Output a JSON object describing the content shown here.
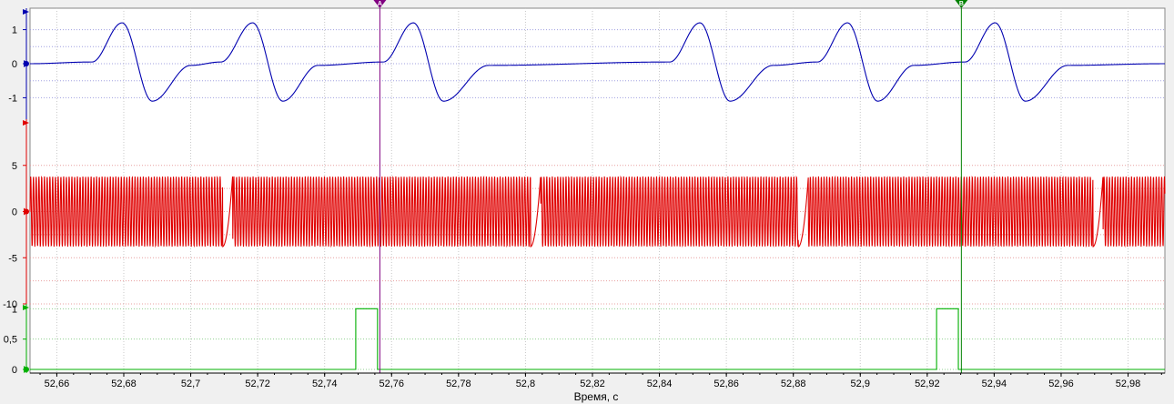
{
  "x_axis": {
    "label": "Время, с",
    "range": [
      52.652,
      52.991
    ],
    "ticks": [
      52.66,
      52.68,
      52.7,
      52.72,
      52.74,
      52.76,
      52.78,
      52.8,
      52.82,
      52.84,
      52.86,
      52.88,
      52.9,
      52.92,
      52.94,
      52.96,
      52.98
    ],
    "tick_labels": [
      "52,66",
      "52,68",
      "52,7",
      "52,72",
      "52,74",
      "52,76",
      "52,78",
      "52,8",
      "52,82",
      "52,84",
      "52,86",
      "52,88",
      "52,9",
      "52,92",
      "52,94",
      "52,96",
      "52,98"
    ]
  },
  "cursors": [
    {
      "name": "cursor-a",
      "letter": "A",
      "time": 52.7565,
      "color": "#800080"
    },
    {
      "name": "cursor-b",
      "letter": "B",
      "time": 52.9302,
      "color": "#008000"
    }
  ],
  "colors": {
    "channel_1": "#0000b0",
    "channel_2": "#e00000",
    "channel_3": "#00b000",
    "grid": "#c8c8c8",
    "plot_background": "#ffffff",
    "frame": "#f0f0f0"
  },
  "chart_data": [
    {
      "type": "line",
      "name": "channel-1",
      "ylim": [
        -1.63,
        1.63
      ],
      "y_ticks": [
        "1",
        "0",
        "-1"
      ],
      "tick_values": [
        1,
        0,
        -1
      ],
      "gridlines": [
        1,
        0.5,
        0,
        -0.5,
        -1
      ],
      "shape": "periodic pulse: positive peak ~1.2 followed by negative peak ~-1.1, baseline 0",
      "x": [
        52.652,
        52.6705,
        52.6795,
        52.6885,
        52.7,
        52.709,
        52.7185,
        52.7275,
        52.738,
        52.7575,
        52.7665,
        52.7755,
        52.789,
        52.8431,
        52.8521,
        52.8611,
        52.874,
        52.8872,
        52.8962,
        52.9052,
        52.916,
        52.9313,
        52.9403,
        52.9493,
        52.962,
        52.991
      ],
      "y": [
        0.0,
        0.05,
        1.2,
        -1.1,
        -0.05,
        0.05,
        1.2,
        -1.1,
        -0.05,
        0.05,
        1.2,
        -1.1,
        -0.05,
        0.05,
        1.2,
        -1.1,
        -0.05,
        0.05,
        1.2,
        -1.1,
        -0.05,
        0.05,
        1.2,
        -1.1,
        -0.05,
        0.0
      ],
      "peaks_time": [
        52.6795,
        52.7185,
        52.7665,
        52.8521,
        52.8962,
        52.9403
      ]
    },
    {
      "type": "line",
      "name": "channel-2",
      "ylim": [
        -10,
        10
      ],
      "y_ticks": [
        "5",
        "0",
        "-5",
        "-10"
      ],
      "tick_values": [
        5,
        0,
        -5,
        -10
      ],
      "gridlines": [
        5,
        2.5,
        0,
        -2.5,
        -5,
        -7.5,
        -10
      ],
      "shape": "sinusoidal oscillation, amplitude ~3.8, with missing-tooth gaps",
      "amplitude": 3.8,
      "period_s": 0.00082,
      "gaps_time": [
        [
          52.7095,
          52.7125
        ],
        [
          52.8015,
          52.8045
        ],
        [
          52.8815,
          52.8845
        ],
        [
          52.9695,
          52.9725
        ]
      ]
    },
    {
      "type": "line",
      "name": "channel-3",
      "ylim": [
        -0.06,
        1.08
      ],
      "y_ticks": [
        "1",
        "0,5",
        "0"
      ],
      "tick_values": [
        1,
        0.5,
        0
      ],
      "gridlines": [
        1,
        0.5,
        0
      ],
      "shape": "digital pulse train, 0 to 1",
      "pulses_time": [
        [
          52.7493,
          52.7558
        ],
        [
          52.9228,
          52.9293
        ]
      ]
    }
  ]
}
